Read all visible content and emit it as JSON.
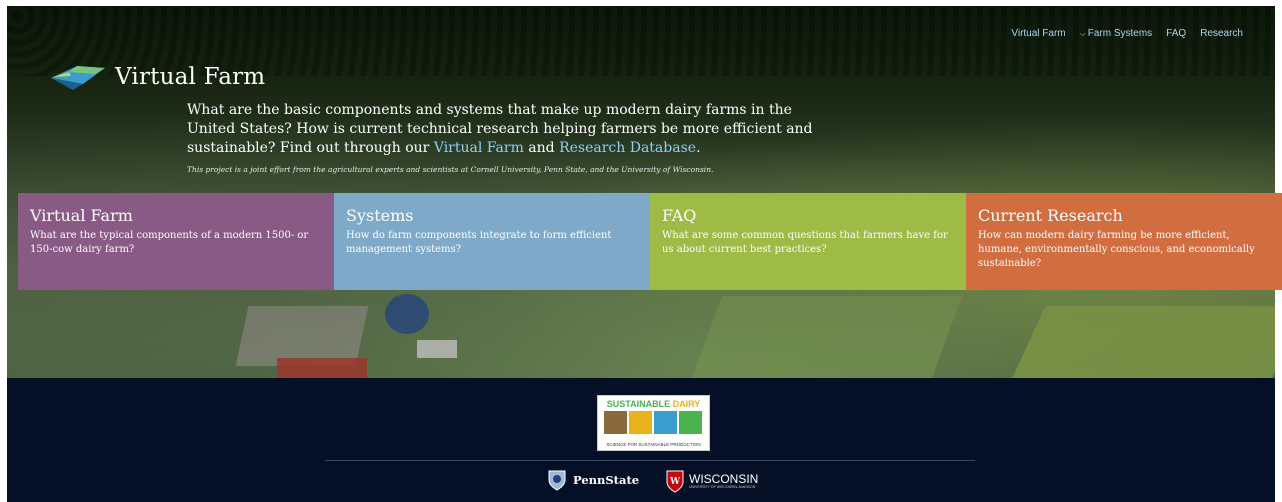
{
  "nav": {
    "items": [
      "Virtual Farm",
      "Farm Systems",
      "FAQ",
      "Research"
    ]
  },
  "site": {
    "title": "Virtual Farm"
  },
  "intro": {
    "line_a": "What are the basic components and systems that make up modern dairy farms in the United States? How is current technical research helping farmers be more efficient and sustainable? Find out through our ",
    "link_vf": "Virtual Farm",
    "and": " and ",
    "link_rd": "Research Database",
    "end": ".",
    "joint_note": "This project is a joint effort from the agricultural experts and scientists at Cornell University, Penn State, and the University of Wisconsin."
  },
  "cards": [
    {
      "title": "Virtual Farm",
      "text": "What are the typical components of a modern 1500- or 150-cow dairy farm?",
      "color": "#8a5a86"
    },
    {
      "title": "Systems",
      "text": "How do farm components integrate to form efficient management systems?",
      "color": "#7fa9c9"
    },
    {
      "title": "FAQ",
      "text": "What are some common questions that farmers have for us about current best practices?",
      "color": "#9dbb45"
    },
    {
      "title": "Current Research",
      "text": "How can modern dairy farming be more efficient, humane, environmentally conscious, and economically sustainable?",
      "color": "#d26d40"
    }
  ],
  "footer": {
    "sustainable": "SUSTAINABLE",
    "dairy": "DAIRY",
    "tagline": "SCIENCE FOR SUSTAINABLE PRODUCTION",
    "pennstate": "PennState",
    "wisconsin": "WISCONSIN",
    "wisconsin_sub": "UNIVERSITY OF WISCONSIN–MADISON"
  },
  "colors": {
    "footer_bg": "#050f26",
    "link": "#8fd0f2",
    "nav_link": "#a9d6f0"
  }
}
